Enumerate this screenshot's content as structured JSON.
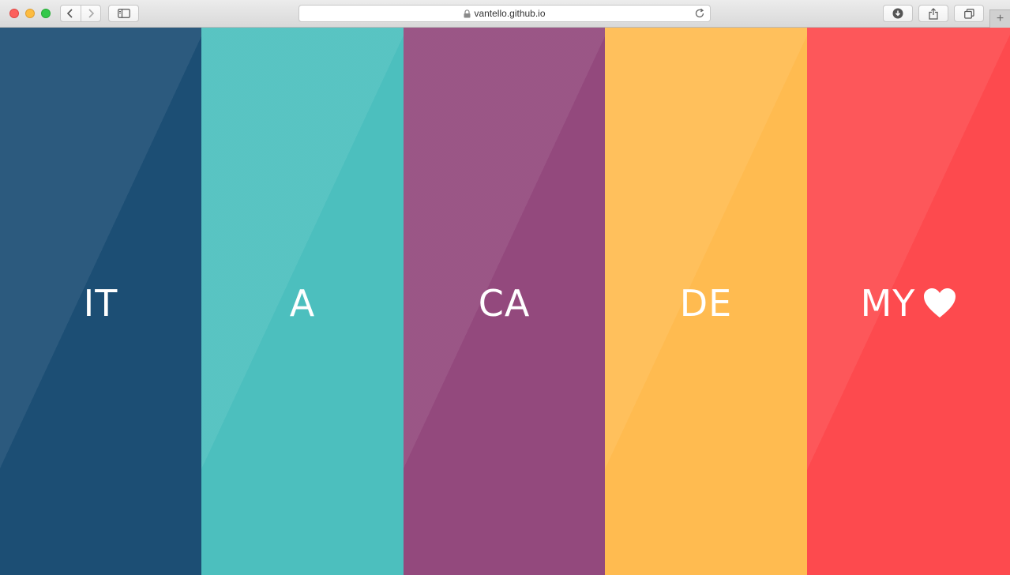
{
  "browser": {
    "url": "vantello.github.io",
    "icons": {
      "back": "chevron-left-icon",
      "forward": "chevron-right-icon",
      "sidebar": "sidebar-icon",
      "lock": "lock-icon",
      "reload": "reload-icon",
      "download": "download-icon",
      "share": "share-icon",
      "tabs": "tabs-overview-icon",
      "new_tab": "plus-icon"
    },
    "new_tab_label": "+"
  },
  "panels": [
    {
      "label": "IT",
      "color": "#1c4e74"
    },
    {
      "label": "A",
      "color": "#4cbfbe"
    },
    {
      "label": "CA",
      "color": "#93497d"
    },
    {
      "label": "DE",
      "color": "#ffbb50"
    },
    {
      "label": "MY",
      "color": "#fd4a4e",
      "icon": "heart-icon"
    }
  ]
}
